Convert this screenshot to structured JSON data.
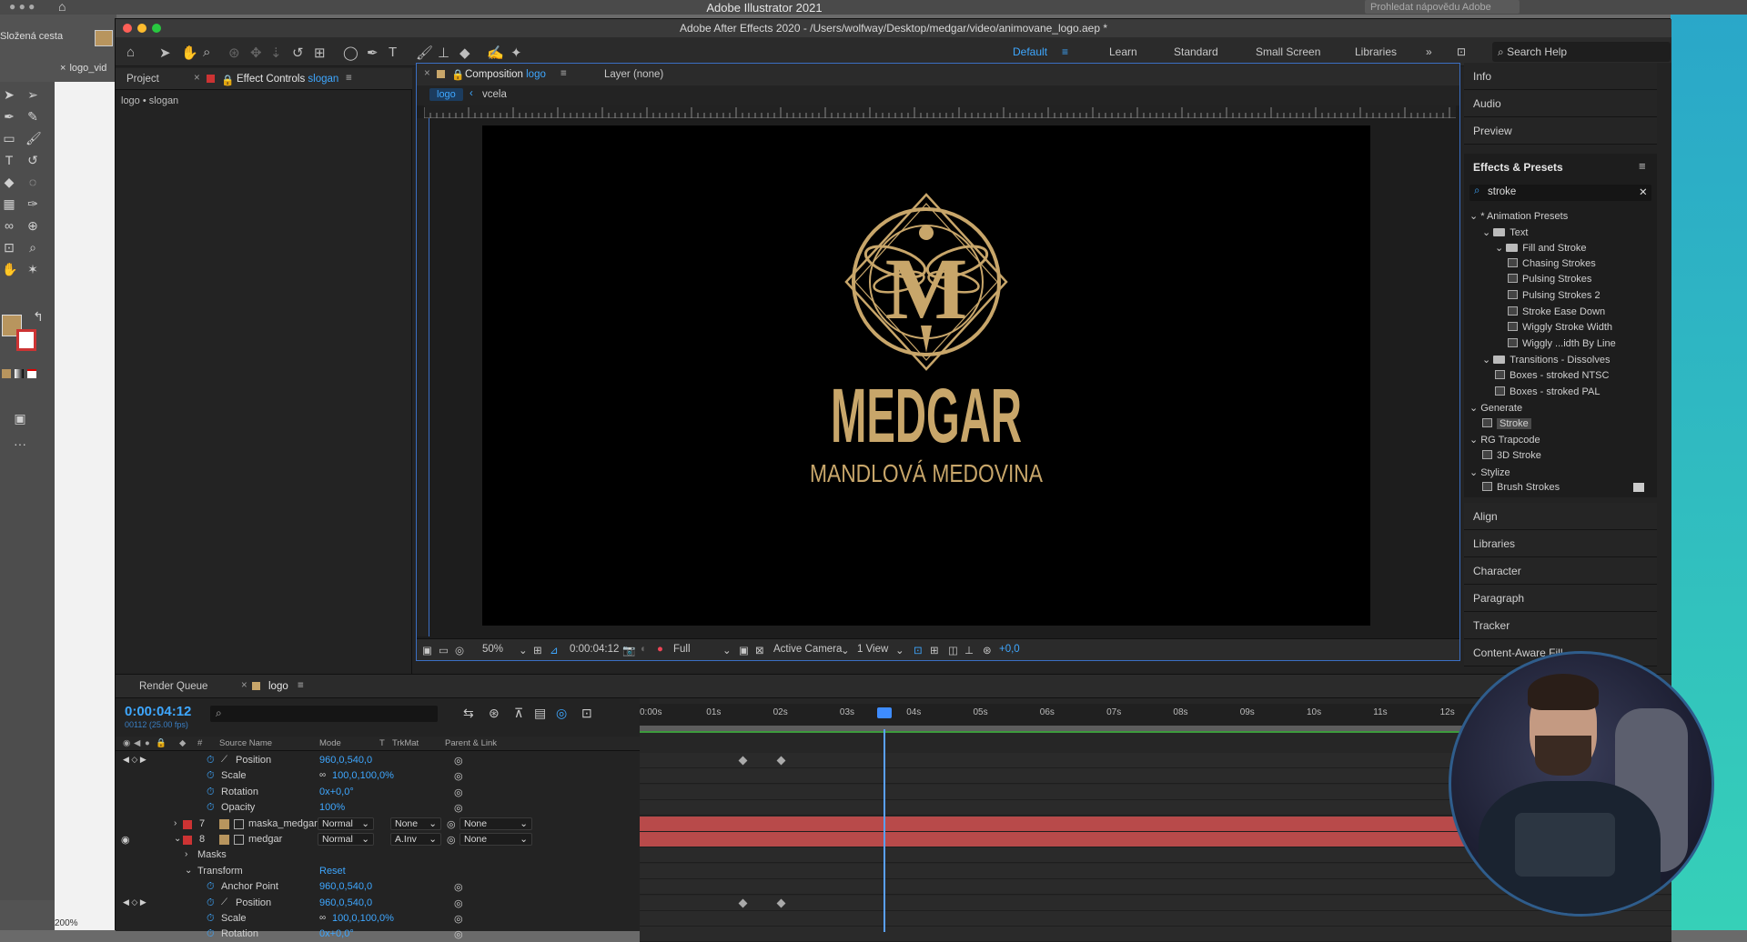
{
  "illustrator": {
    "app_title": "Adobe Illustrator 2021",
    "search_placeholder": "Prohledat nápovědu Adobe",
    "path_label": "Složená cesta",
    "doc_tab": "logo_vid",
    "zoom": "200%"
  },
  "ae": {
    "window_title": "Adobe After Effects 2020 - /Users/wolfway/Desktop/medgar/video/animovane_logo.aep *",
    "workspaces": [
      "Default",
      "Learn",
      "Standard",
      "Small Screen",
      "Libraries"
    ],
    "search_help": "Search Help",
    "left_panel": {
      "tab_project": "Project",
      "tab_effect_controls": "Effect Controls",
      "tab_effect_layer": "slogan",
      "breadcrumb": "logo • slogan"
    },
    "composition": {
      "tab_label": "Composition",
      "tab_comp_name": "logo",
      "layer_tab": "Layer (none)",
      "sub_tabs": [
        "logo",
        "vcela"
      ],
      "logo_monogram": "M",
      "logo_name": "MEDGAR",
      "logo_slogan": "MANDLOVÁ MEDOVINA",
      "footer": {
        "zoom": "50%",
        "timecode": "0:00:04:12",
        "resolution": "Full",
        "camera": "Active Camera",
        "views": "1 View",
        "exposure": "+0,0"
      }
    },
    "right_panels": {
      "top": [
        "Info",
        "Audio",
        "Preview"
      ],
      "effects_title": "Effects & Presets",
      "effects_search": "stroke",
      "bottom": [
        "Align",
        "Libraries",
        "Character",
        "Paragraph",
        "Tracker",
        "Content-Aware Fill"
      ]
    },
    "effects_tree": [
      {
        "label": "* Animation Presets",
        "level": 0,
        "kind": "group"
      },
      {
        "label": "Text",
        "level": 1,
        "kind": "folder"
      },
      {
        "label": "Fill and Stroke",
        "level": 2,
        "kind": "folder"
      },
      {
        "label": "Chasing Strokes",
        "level": 3,
        "kind": "fx"
      },
      {
        "label": "Pulsing Strokes",
        "level": 3,
        "kind": "fx"
      },
      {
        "label": "Pulsing Strokes 2",
        "level": 3,
        "kind": "fx"
      },
      {
        "label": "Stroke Ease Down",
        "level": 3,
        "kind": "fx"
      },
      {
        "label": "Wiggly Stroke Width",
        "level": 3,
        "kind": "fx"
      },
      {
        "label": "Wiggly ...idth By Line",
        "level": 3,
        "kind": "fx"
      },
      {
        "label": "Transitions - Dissolves",
        "level": 1,
        "kind": "folder"
      },
      {
        "label": "Boxes - stroked NTSC",
        "level": 2,
        "kind": "fx"
      },
      {
        "label": "Boxes - stroked PAL",
        "level": 2,
        "kind": "fx"
      },
      {
        "label": "Generate",
        "level": 0,
        "kind": "group"
      },
      {
        "label": "Stroke",
        "level": 1,
        "kind": "fx",
        "selected": true
      },
      {
        "label": "RG Trapcode",
        "level": 0,
        "kind": "group"
      },
      {
        "label": "3D Stroke",
        "level": 1,
        "kind": "fx"
      },
      {
        "label": "Stylize",
        "level": 0,
        "kind": "group"
      },
      {
        "label": "Brush Strokes",
        "level": 1,
        "kind": "fx"
      }
    ],
    "timeline": {
      "tab_render_queue": "Render Queue",
      "tab_comp": "logo",
      "current_time": "0:00:04:12",
      "fps": "00112 (25.00 fps)",
      "columns": {
        "source": "Source Name",
        "mode": "Mode",
        "t": "T",
        "trkmat": "TrkMat",
        "parent": "Parent & Link"
      },
      "ruler": [
        "0:00s",
        "01s",
        "02s",
        "03s",
        "04s",
        "05s",
        "06s",
        "07s",
        "08s",
        "09s",
        "10s",
        "11s",
        "12s"
      ],
      "rows": [
        {
          "type": "prop",
          "name": "Position",
          "value": "960,0,540,0",
          "keyframed": true
        },
        {
          "type": "prop",
          "name": "Scale",
          "value": "100,0,100,0%",
          "link": true
        },
        {
          "type": "prop",
          "name": "Rotation",
          "value": "0x+0,0°"
        },
        {
          "type": "prop",
          "name": "Opacity",
          "value": "100%"
        },
        {
          "type": "layer",
          "num": "7",
          "name": "maska_medgar",
          "mode": "Normal",
          "trkmat": "None",
          "parent": "None"
        },
        {
          "type": "layer",
          "num": "8",
          "name": "medgar",
          "mode": "Normal",
          "trkmat": "A.Inv",
          "parent": "None"
        },
        {
          "type": "group",
          "name": "Masks"
        },
        {
          "type": "group",
          "name": "Transform",
          "value": "Reset"
        },
        {
          "type": "prop",
          "name": "Anchor Point",
          "value": "960,0,540,0"
        },
        {
          "type": "prop",
          "name": "Position",
          "value": "960,0,540,0",
          "keyframed": true
        },
        {
          "type": "prop",
          "name": "Scale",
          "value": "100,0,100,0%",
          "link": true
        },
        {
          "type": "prop",
          "name": "Rotation",
          "value": "0x+0,0°"
        }
      ]
    }
  },
  "colors": {
    "gold": "#c8a66a",
    "accent_blue": "#3ea7ff",
    "layer_red": "#b84a4a"
  }
}
